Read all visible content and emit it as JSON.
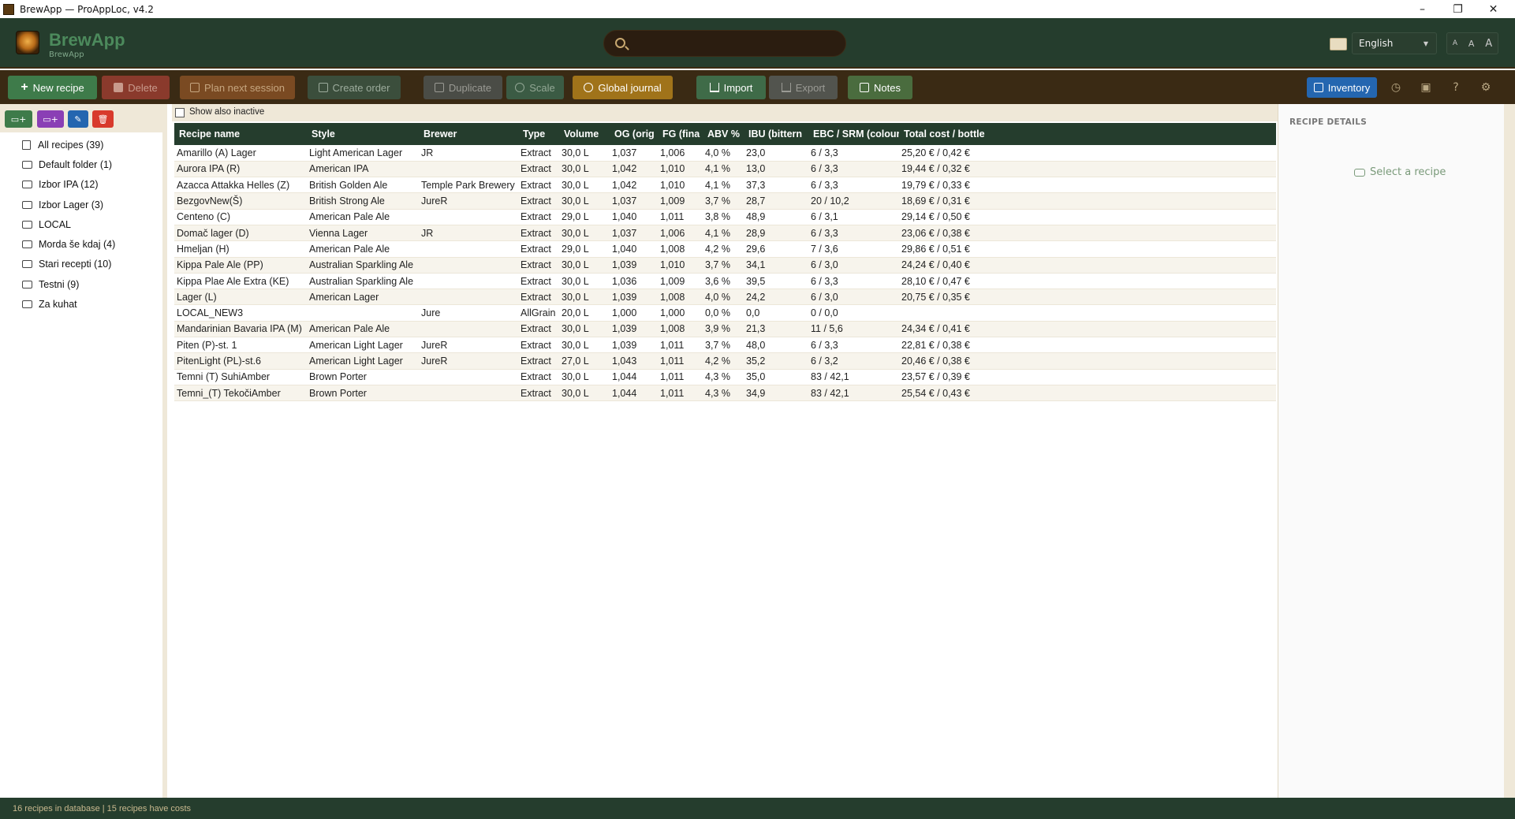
{
  "window": {
    "title": "BrewApp — ProAppLoc, v4.2",
    "controls": [
      "–",
      "❐",
      "✕"
    ]
  },
  "header": {
    "brand": "BrewApp",
    "brand_sub": "BrewApp",
    "search_placeholder": "",
    "language": "English",
    "font_sizes": [
      "A",
      "A",
      "A"
    ]
  },
  "toolbar": {
    "new_recipe": "New recipe",
    "delete": "Delete",
    "plan_next_session": "Plan next session",
    "create_order": "Create order",
    "duplicate": "Duplicate",
    "scale": "Scale",
    "global_journal": "Global journal",
    "import": "Import",
    "export": "Export",
    "notes": "Notes",
    "inventory": "Inventory"
  },
  "sidebar": {
    "items": [
      {
        "label": "All recipes (39)",
        "icon": "book-icon"
      },
      {
        "label": "Default folder (1)",
        "icon": "folder-icon"
      },
      {
        "label": "Izbor IPA (12)",
        "icon": "folder-icon"
      },
      {
        "label": "Izbor Lager (3)",
        "icon": "folder-icon"
      },
      {
        "label": "LOCAL",
        "icon": "folder-icon"
      },
      {
        "label": "Morda še kdaj (4)",
        "icon": "folder-icon"
      },
      {
        "label": "Stari recepti (10)",
        "icon": "folder-icon"
      },
      {
        "label": "Testni (9)",
        "icon": "folder-icon"
      },
      {
        "label": "Za kuhat",
        "icon": "folder-icon"
      }
    ]
  },
  "main": {
    "show_inactive_label": "Show also inactive",
    "columns": [
      "Recipe name",
      "Style",
      "Brewer",
      "Type",
      "Volume",
      "OG (orig",
      "FG (fina",
      "ABV %",
      "IBU (bittern",
      "EBC / SRM (colour",
      "Total cost / bottle"
    ],
    "rows": [
      [
        "Amarillo (A) Lager",
        "Light American Lager",
        "JR",
        "Extract",
        "30,0 L",
        "1,037",
        "1,006",
        "4,0 %",
        "23,0",
        "6 / 3,3",
        "25,20 € / 0,42 €"
      ],
      [
        "Aurora IPA (R)",
        "American IPA",
        "",
        "Extract",
        "30,0 L",
        "1,042",
        "1,010",
        "4,1 %",
        "13,0",
        "6 / 3,3",
        "19,44 € / 0,32 €"
      ],
      [
        "Azacca Attakka Helles (Z)",
        "British Golden Ale",
        "Temple Park Brewery",
        "Extract",
        "30,0 L",
        "1,042",
        "1,010",
        "4,1 %",
        "37,3",
        "6 / 3,3",
        "19,79 € / 0,33 €"
      ],
      [
        "BezgovNew(Š)",
        "British Strong Ale",
        "JureR",
        "Extract",
        "30,0 L",
        "1,037",
        "1,009",
        "3,7 %",
        "28,7",
        "20 / 10,2",
        "18,69 € / 0,31 €"
      ],
      [
        "Centeno (C)",
        "American Pale Ale",
        "",
        "Extract",
        "29,0 L",
        "1,040",
        "1,011",
        "3,8 %",
        "48,9",
        "6 / 3,1",
        "29,14 € / 0,50 €"
      ],
      [
        "Domač lager (D)",
        "Vienna Lager",
        "JR",
        "Extract",
        "30,0 L",
        "1,037",
        "1,006",
        "4,1 %",
        "28,9",
        "6 / 3,3",
        "23,06 € / 0,38 €"
      ],
      [
        "Hmeljan (H)",
        "American Pale Ale",
        "",
        "Extract",
        "29,0 L",
        "1,040",
        "1,008",
        "4,2 %",
        "29,6",
        "7 / 3,6",
        "29,86 € / 0,51 €"
      ],
      [
        "Kippa Pale Ale (PP)",
        "Australian Sparkling Ale",
        "",
        "Extract",
        "30,0 L",
        "1,039",
        "1,010",
        "3,7 %",
        "34,1",
        "6 / 3,0",
        "24,24 € / 0,40 €"
      ],
      [
        "Kippa Plae Ale Extra (KE)",
        "Australian Sparkling Ale",
        "",
        "Extract",
        "30,0 L",
        "1,036",
        "1,009",
        "3,6 %",
        "39,5",
        "6 / 3,3",
        "28,10 € / 0,47 €"
      ],
      [
        "Lager (L)",
        "American Lager",
        "",
        "Extract",
        "30,0 L",
        "1,039",
        "1,008",
        "4,0 %",
        "24,2",
        "6 / 3,0",
        "20,75 € / 0,35 €"
      ],
      [
        "LOCAL_NEW3",
        "",
        "Jure",
        "AllGrain",
        "20,0 L",
        "1,000",
        "1,000",
        "0,0 %",
        "0,0",
        "0 / 0,0",
        ""
      ],
      [
        "Mandarinian Bavaria IPA (M)",
        "American Pale Ale",
        "",
        "Extract",
        "30,0 L",
        "1,039",
        "1,008",
        "3,9 %",
        "21,3",
        "11 / 5,6",
        "24,34 € / 0,41 €"
      ],
      [
        "Piten (P)-st. 1",
        "American Light Lager",
        "JureR",
        "Extract",
        "30,0 L",
        "1,039",
        "1,011",
        "3,7 %",
        "48,0",
        "6 / 3,3",
        "22,81 € / 0,38 €"
      ],
      [
        "PitenLight (PL)-st.6",
        "American Light Lager",
        "JureR",
        "Extract",
        "27,0 L",
        "1,043",
        "1,011",
        "4,2 %",
        "35,2",
        "6 / 3,2",
        "20,46 € / 0,38 €"
      ],
      [
        "Temni (T) SuhiAmber",
        "Brown Porter",
        "",
        "Extract",
        "30,0 L",
        "1,044",
        "1,011",
        "4,3 %",
        "35,0",
        "83 / 42,1",
        "23,57 € / 0,39 €"
      ],
      [
        "Temni_(T) TekočiAmber",
        "Brown Porter",
        "",
        "Extract",
        "30,0 L",
        "1,044",
        "1,011",
        "4,3 %",
        "34,9",
        "83 / 42,1",
        "25,54 € / 0,43 €"
      ]
    ]
  },
  "details": {
    "title": "RECIPE DETAILS",
    "empty_text": "Select a recipe"
  },
  "status": {
    "text": "16 recipes in database | 15 recipes have costs"
  },
  "colors": {
    "header_green": "#253d2d",
    "toolbar_brown": "#3a2a14",
    "accent_blue": "#2466b0"
  }
}
